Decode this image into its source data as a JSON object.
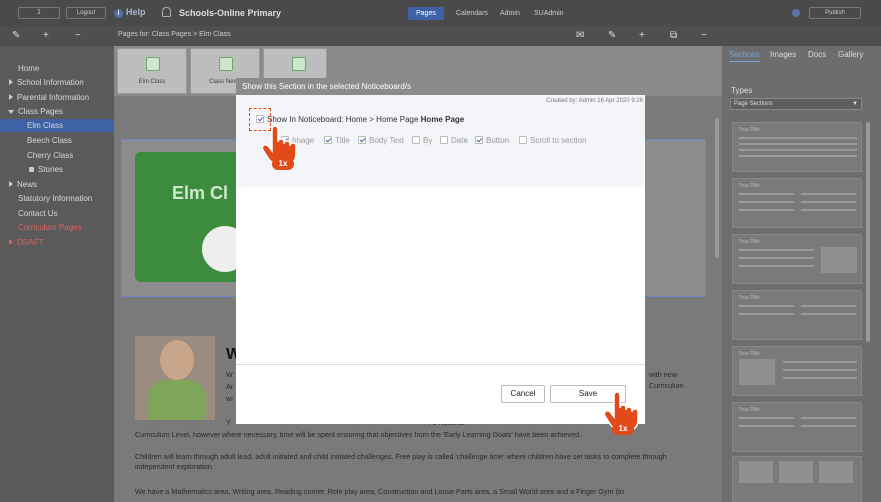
{
  "topbar": {
    "page_input": "1",
    "logout": "Logout",
    "help": "Help",
    "site_title": "Schools-Online Primary",
    "nav": [
      "Pages",
      "Calendars",
      "Admin",
      "SUAdmin"
    ],
    "publish": "Publish"
  },
  "breadcrumb": "Pages for: Class Pages > Elm Class",
  "thumbs": [
    "Elm Class",
    "Class News"
  ],
  "sidebar": {
    "items": [
      {
        "label": "Home"
      },
      {
        "label": "School Information"
      },
      {
        "label": "Parental Information"
      },
      {
        "label": "Class Pages"
      },
      {
        "label": "Elm Class"
      },
      {
        "label": "Beech Class"
      },
      {
        "label": "Cherry Class"
      },
      {
        "label": "Stories"
      },
      {
        "label": "News"
      },
      {
        "label": "Statutory Information"
      },
      {
        "label": "Contact Us"
      },
      {
        "label": "Curriculum Pages"
      },
      {
        "label": "DRAFT"
      }
    ]
  },
  "content": {
    "banner_text": "Elm Cl",
    "heading_letter": "W",
    "frag_right": [
      "with new",
      "Curriculum"
    ],
    "frag_left": [
      "W",
      "Ar",
      "wi"
    ],
    "line1": "Y                                                                                                   f 1 National",
    "line2": "Curriculum Level, however where necessary, time will be spent ensuring that objectives from the 'Early Learning Goals' have been achieved.",
    "para2": "Children will learn through adult lead, adult initiated and child initiated challenges. Free play is called 'challenge time' where children have set tasks to complete through independent exploration.",
    "para3": "We have a Mathematics area, Writing area, Reading corner, Role play area, Construction and Loose Parts area, a Small World area and a Finger Gym (to"
  },
  "right_panel": {
    "tabs": [
      "Sections",
      "Images",
      "Docs",
      "Gallery"
    ],
    "types_label": "Types",
    "types_value": "Page Sections",
    "template_title": "Your Title"
  },
  "modal": {
    "title": "Show this Section in the selected Noticeboard/s",
    "created": "Created by: Admin 16 Apr 2020 9:26",
    "show_label": "Show In Noticeboard: Home > Home Page",
    "show_bold": "Home Page",
    "options": [
      "Image",
      "Title",
      "Body Text",
      "By",
      "Date",
      "Button",
      "Scroll to section"
    ],
    "cancel": "Cancel",
    "save": "Save"
  },
  "annotations": {
    "click_badge_1": "1x",
    "click_badge_2": "1x"
  },
  "colors": {
    "accent": "#3f62a6",
    "click_marker": "#e24a1a"
  }
}
